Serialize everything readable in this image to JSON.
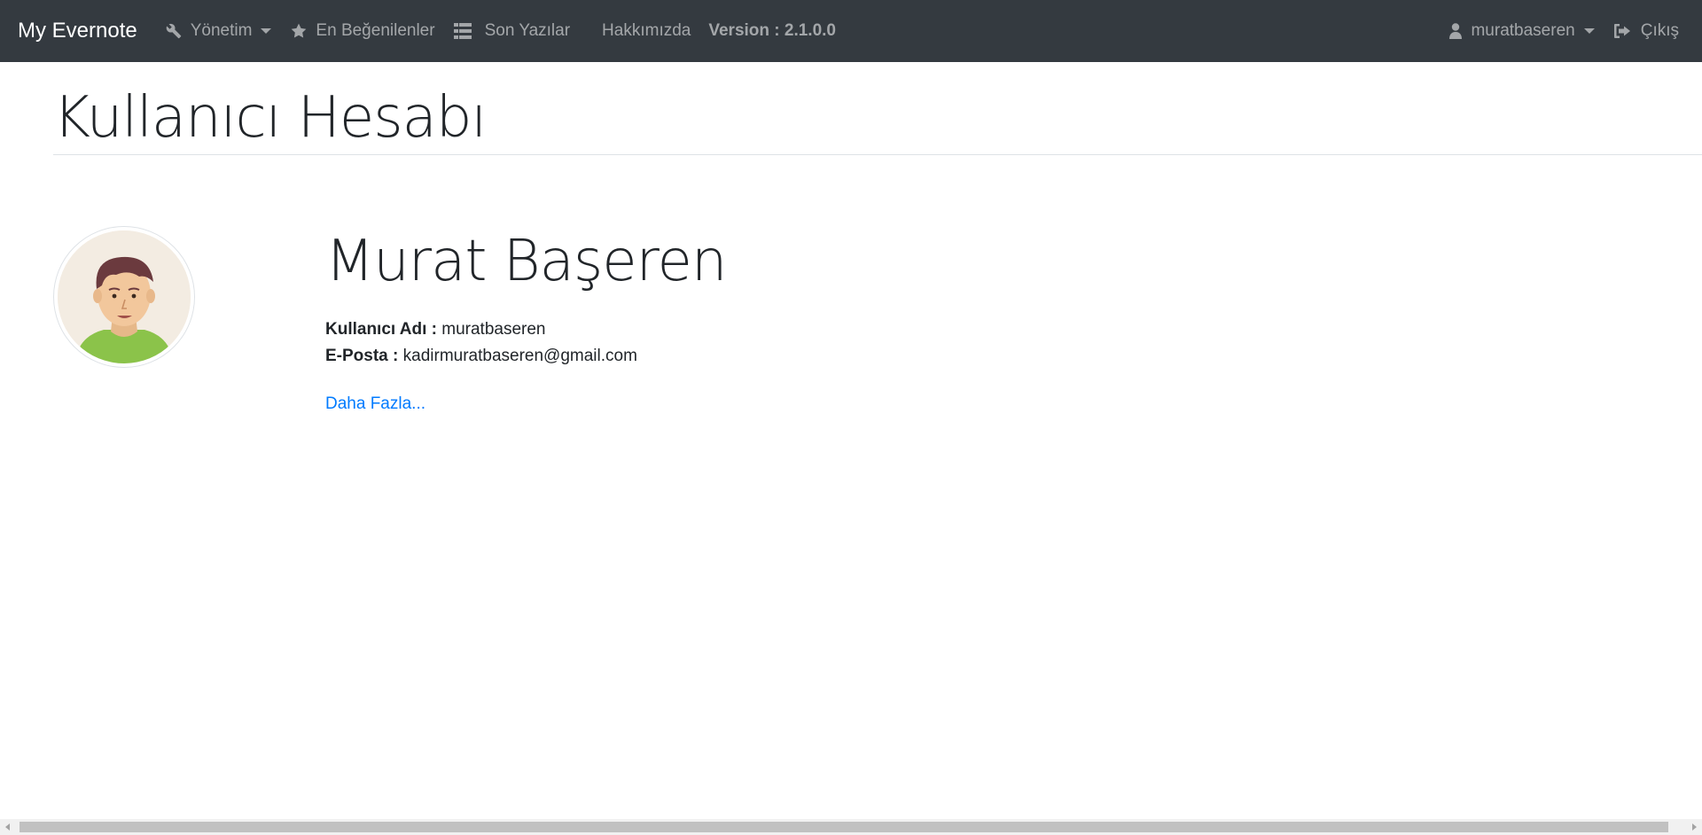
{
  "navbar": {
    "brand": "My Evernote",
    "items": [
      {
        "label": "Yönetim",
        "icon": "wrench-icon"
      },
      {
        "label": "En Beğenilenler",
        "icon": "star-icon"
      },
      {
        "label": "Son Yazılar",
        "icon": "list-icon"
      },
      {
        "label": "Hakkımızda"
      }
    ],
    "version": "Version : 2.1.0.0",
    "user_menu": {
      "label": "muratbaseren",
      "icon": "user-icon"
    },
    "logout": {
      "label": "Çıkış",
      "icon": "sign-out-icon"
    }
  },
  "page": {
    "title": "Kullanıcı Hesabı"
  },
  "profile": {
    "name": "Murat Başeren",
    "username_label": "Kullanıcı Adı :",
    "username": "muratbaseren",
    "email_label": "E-Posta :",
    "email": "kadirmuratbaseren@gmail.com",
    "more_link": "Daha Fazla..."
  },
  "colors": {
    "navbar_bg": "#343a40",
    "link": "#007bff",
    "avatar_shirt": "#8bc34a",
    "avatar_hair": "#6b3a3e"
  }
}
